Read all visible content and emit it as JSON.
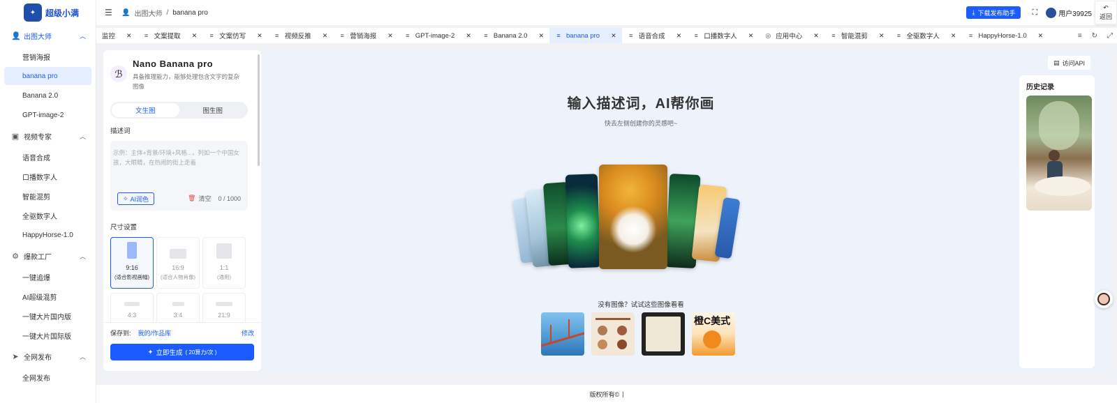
{
  "brand": {
    "name": "超级小满"
  },
  "sidebar": {
    "groups": [
      {
        "label": "出图大师",
        "icon": "user-plus-icon",
        "items": [
          "营销海报",
          "banana pro",
          "Banana 2.0",
          "GPT-image-2"
        ]
      },
      {
        "label": "视频专家",
        "icon": "video-icon",
        "items": [
          "语音合成",
          "口播数字人",
          "智能混剪",
          "全驱数字人",
          "HappyHorse-1.0"
        ]
      },
      {
        "label": "爆款工厂",
        "icon": "factory-icon",
        "items": [
          "一键追爆",
          "AI超级混剪",
          "一键大片国内版",
          "一键大片国际版"
        ]
      },
      {
        "label": "全网发布",
        "icon": "send-icon",
        "items": [
          "全网发布"
        ]
      }
    ],
    "active_item": "banana pro"
  },
  "topbar": {
    "breadcrumb": [
      "出图大师",
      "banana pro"
    ],
    "download_label": "下载发布助手",
    "user_name": "用户39925",
    "back_label": "返回"
  },
  "tabs": [
    {
      "label": "监控",
      "active": false
    },
    {
      "label": "文案提取",
      "active": false
    },
    {
      "label": "文案仿写",
      "active": false
    },
    {
      "label": "视频反推",
      "active": false
    },
    {
      "label": "营销海报",
      "active": false
    },
    {
      "label": "GPT-image-2",
      "active": false
    },
    {
      "label": "Banana 2.0",
      "active": false
    },
    {
      "label": "banana pro",
      "active": true
    },
    {
      "label": "语音合成",
      "active": false
    },
    {
      "label": "口播数字人",
      "active": false
    },
    {
      "label": "应用中心",
      "active": false
    },
    {
      "label": "智能混剪",
      "active": false
    },
    {
      "label": "全驱数字人",
      "active": false
    },
    {
      "label": "HappyHorse-1.0",
      "active": false
    }
  ],
  "panel": {
    "model_name": "Nano Banana pro",
    "model_desc": "具备推理能力，能够处理包含文字的复杂图像",
    "mode_tabs": [
      "文生图",
      "图生图"
    ],
    "active_mode": "文生图",
    "prompt_label": "描述词",
    "prompt_placeholder": "示例：主体+背景/环境+风格...，列如一个中国女孩，大眼睛，在热闹的街上走着",
    "ai_polish": "AI润色",
    "clear": "清空",
    "char_count": "0 / 1000",
    "size_label": "尺寸设置",
    "sizes": [
      {
        "ratio": "9:16",
        "desc": "(适合影视画幅)",
        "selected": true
      },
      {
        "ratio": "16:9",
        "desc": "(适合人物肖像)",
        "selected": false
      },
      {
        "ratio": "1:1",
        "desc": "(通用)",
        "selected": false
      },
      {
        "ratio": "4:3",
        "desc": "",
        "selected": false
      },
      {
        "ratio": "3:4",
        "desc": "",
        "selected": false
      },
      {
        "ratio": "21:9",
        "desc": "",
        "selected": false
      }
    ],
    "save_label": "保存到:",
    "save_path": "我的/作品库",
    "edit": "修改",
    "generate": "立即生成",
    "generate_cost": "( 20算力/次 )"
  },
  "main": {
    "api_label": "访问API",
    "title": "输入描述词，AI帮你画",
    "subtitle": "快去左侧创建你的灵感吧~",
    "try_hint": "没有图像？试试这些图像看看",
    "samples": [
      "golden-gate-bridge",
      "coffee-infographic",
      "tablet-notes",
      "orange-drink-poster"
    ],
    "sample4_text": "橙C美式",
    "history_title": "历史记录"
  },
  "footer": {
    "copyright": "版权所有©"
  },
  "colors": {
    "primary": "#1a5cff",
    "active_bg": "#e6efff",
    "main_bg": "#eef2fa"
  }
}
